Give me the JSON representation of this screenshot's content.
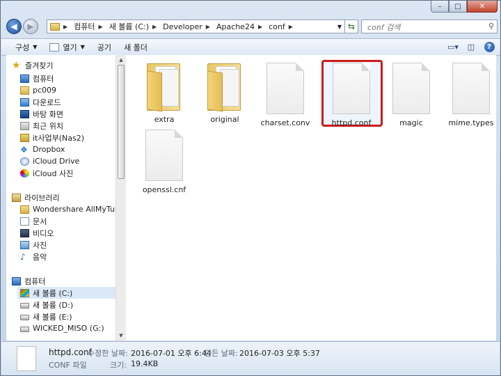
{
  "window": {
    "buttons": {
      "minimize": "–",
      "maximize": "□",
      "close": "✕"
    }
  },
  "nav": {
    "back_icon": "back-arrow-icon",
    "forward_icon": "forward-arrow-icon",
    "breadcrumbs": [
      "컴퓨터",
      "새 볼륨 (C:)",
      "Developer",
      "Apache24",
      "conf"
    ],
    "search_placeholder": "conf 검색"
  },
  "toolbar": {
    "organize": "구성",
    "open": "열기",
    "share": "공기",
    "new_folder": "새 폴더"
  },
  "sidebar": {
    "favorites": {
      "label": "즐겨찾기",
      "items": [
        "컴퓨터",
        "pc009",
        "다운로드",
        "바탕 화면",
        "최근 위치",
        "it사업부(Nas2)",
        "Dropbox",
        "iCloud Drive",
        "iCloud 사진"
      ]
    },
    "libraries": {
      "label": "라이브러리",
      "items": [
        "Wondershare AllMyTube",
        "문서",
        "비디오",
        "사진",
        "음악"
      ]
    },
    "computer": {
      "label": "컴퓨터",
      "items": [
        "새 볼륨 (C:)",
        "새 볼륨 (D:)",
        "새 볼륨 (E:)",
        "WICKED_MISO (G:)"
      ],
      "selected": "새 볼륨 (C:)"
    }
  },
  "files": [
    {
      "name": "extra",
      "type": "folder"
    },
    {
      "name": "original",
      "type": "folder"
    },
    {
      "name": "charset.conv",
      "type": "file"
    },
    {
      "name": "httpd.conf",
      "type": "file",
      "selected": true
    },
    {
      "name": "magic",
      "type": "file"
    },
    {
      "name": "mime.types",
      "type": "file"
    },
    {
      "name": "openssl.cnf",
      "type": "file"
    }
  ],
  "details": {
    "name": "httpd.conf",
    "type": "CONF 파일",
    "modified_label": "수정한 날짜:",
    "modified_value": "2016-07-01 오후 6:44",
    "created_label": "만든 날짜:",
    "created_value": "2016-07-03 오후 5:37",
    "size_label": "크기:",
    "size_value": "19.4KB"
  },
  "colors": {
    "selection_highlight": "#cc1a1a",
    "window_frame": "#c3d4ea"
  }
}
